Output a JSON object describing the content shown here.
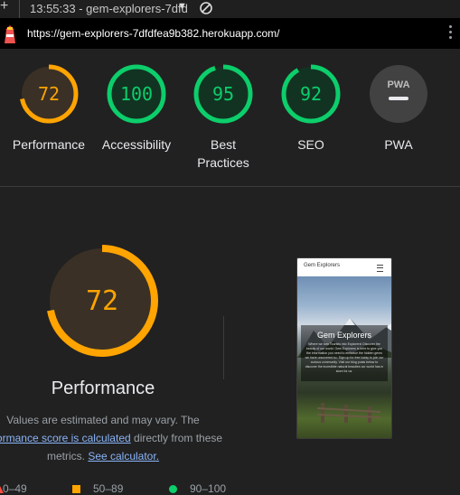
{
  "browser": {
    "new_tab_symbol": "+",
    "tab_title": "13:55:33 - gem-explorers-7dfd",
    "url": "https://gem-explorers-7dfdfea9b382.herokuapp.com/"
  },
  "scores": [
    {
      "label": "Performance",
      "value": "72",
      "fraction": 0.72,
      "color": "#ffa400"
    },
    {
      "label": "Accessibility",
      "value": "100",
      "fraction": 1.0,
      "color": "#0cce6b"
    },
    {
      "label": "Best Practices",
      "value": "95",
      "fraction": 0.95,
      "color": "#0cce6b"
    },
    {
      "label": "SEO",
      "value": "92",
      "fraction": 0.92,
      "color": "#0cce6b"
    },
    {
      "label": "PWA",
      "value": "PWA",
      "color": "#9aa0a6"
    }
  ],
  "main": {
    "score": "72",
    "fraction": 0.72,
    "title": "Performance",
    "note_part1": "Values are estimated and may vary. The",
    "note_link1": "erformance score is calculated",
    "note_part2": "directly from these metrics.",
    "note_link2": "See calculator."
  },
  "screenshot": {
    "brand": "Gem Explorers",
    "hero_title": "Gem Explorers",
    "hero_text": "Where we turn Tourists into Explorers! Discover the beauty of our world. Gem Explorers is here to give you the information you need to embrace the hidden gems we have uncovered so. Sign up for free today to join our curious community. Visit our blog posts below to discover the incredible natural beauties our world has in store for us."
  },
  "legend": {
    "low": "0–49",
    "mid": "50–89",
    "high": "90–100"
  },
  "colors": {
    "fail": "#ff4e42",
    "average": "#ffa400",
    "pass": "#0cce6b"
  }
}
